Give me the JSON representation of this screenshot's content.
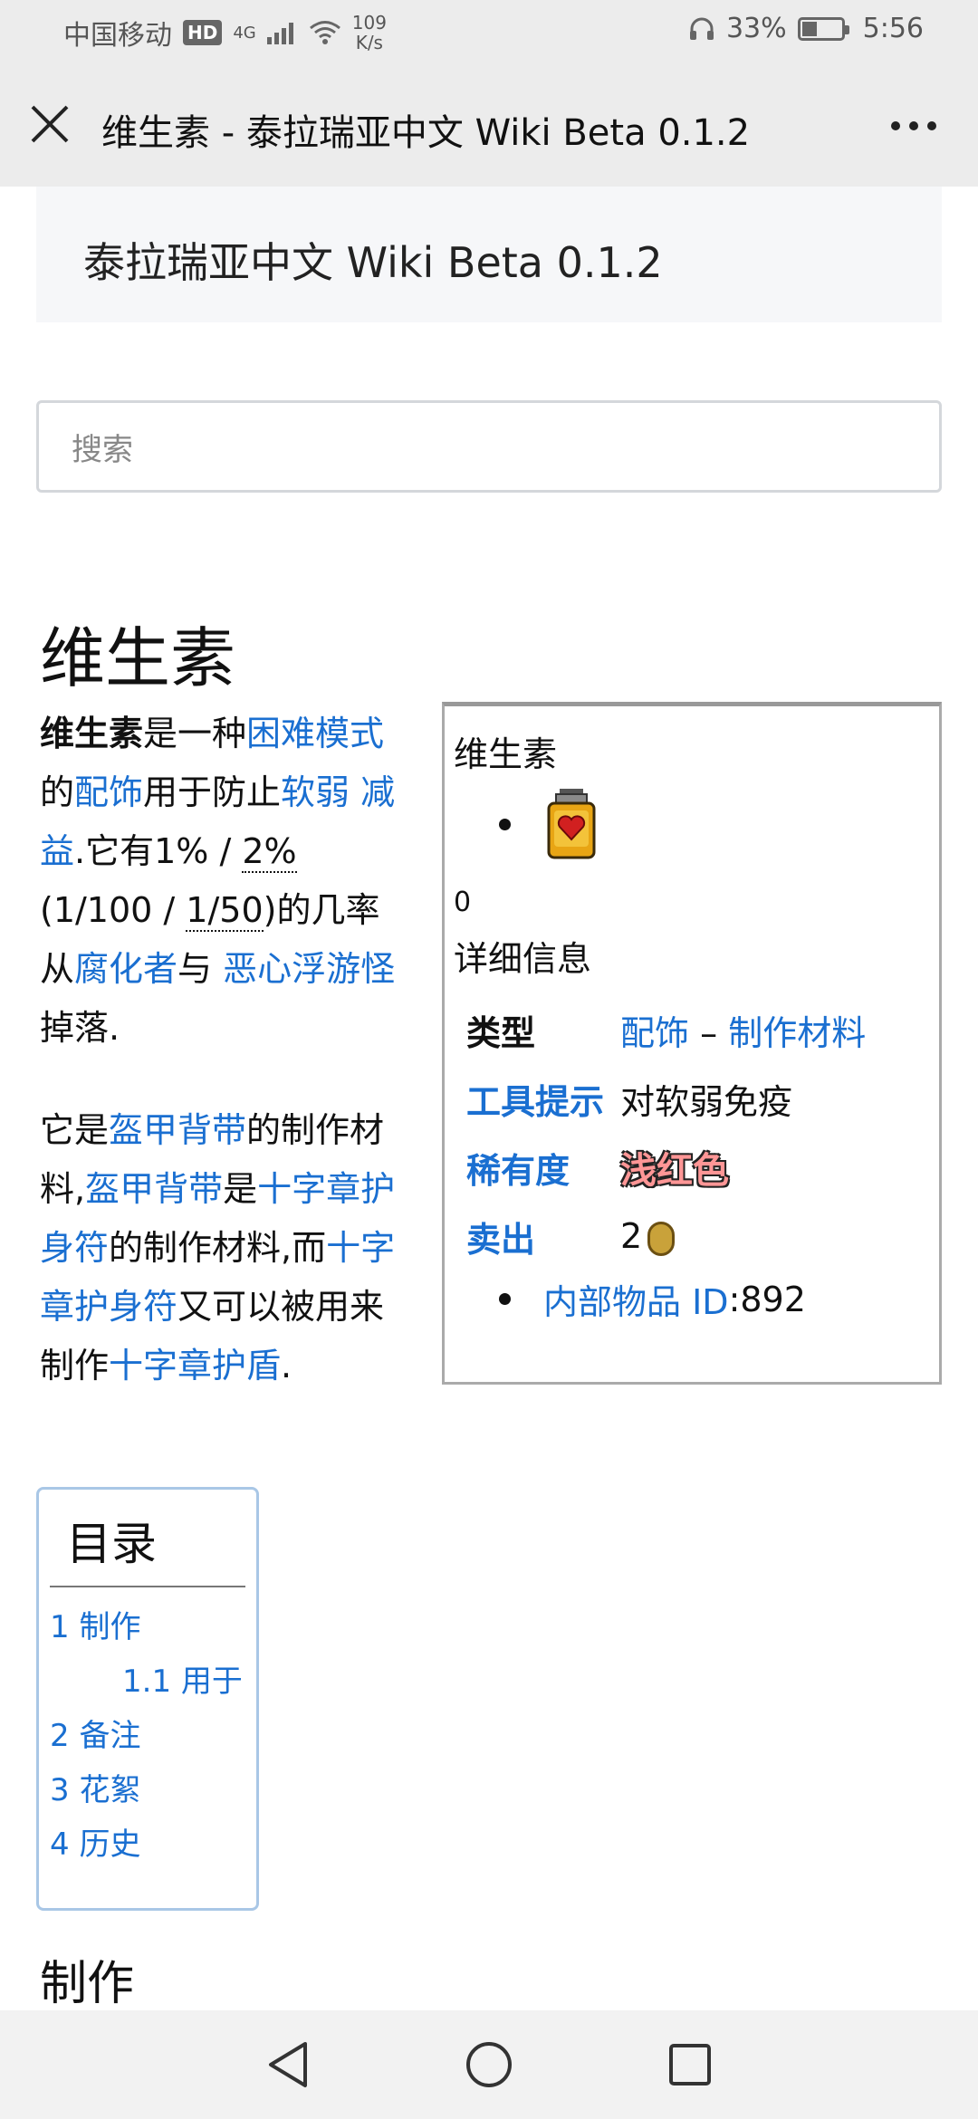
{
  "status": {
    "carrier": "中国移动",
    "hd": "HD",
    "net": "4G",
    "speed_value": "109",
    "speed_unit": "K/s",
    "battery": "33%",
    "time": "5:56"
  },
  "appbar": {
    "title": "维生素 - 泰拉瑞亚中文 Wiki Beta 0.1.2"
  },
  "site": {
    "banner": "泰拉瑞亚中文 Wiki Beta 0.1.2",
    "search_placeholder": "搜索"
  },
  "page": {
    "title": "维生素",
    "p1": {
      "term": "维生素",
      "t1": "是一种",
      "l1": "困难模式",
      "t2": "的",
      "l2": "配饰",
      "t3": "用于防止",
      "l3": "软弱 减益",
      "t4": ".它有1% / ",
      "abbr1": "2%",
      "t5": "(1/100 / ",
      "abbr2": "1/50",
      "t6": ")的几率从",
      "l4": "腐化者",
      "t7": "与 ",
      "l5": "恶心浮游怪",
      "t8": "掉落."
    },
    "p2": {
      "t1": "它是",
      "l1": "盔甲背带",
      "t2": "的制作材料,",
      "l2": "盔甲背带",
      "t3": "是",
      "l3": "十字章护身符",
      "t4": "的制作材料,而",
      "l4": "十字章护身符",
      "t5": "又可以被用来制作",
      "l5": "十字章护盾",
      "t6": "."
    }
  },
  "infobox": {
    "title": "维生素",
    "zero": "0",
    "details_heading": "详细信息",
    "type_label": "类型",
    "type_link1": "配饰",
    "type_sep": " – ",
    "type_link2": "制作材料",
    "tooltip_label": "工具提示",
    "tooltip_value": "对软弱免疫",
    "rarity_label": "稀有度",
    "rarity_value": "浅红色",
    "sell_label": "卖出",
    "sell_value": "2",
    "id_label": "内部物品 ID",
    "id_sep": ": ",
    "id_value": "892",
    "colors": {
      "rarity": "#ff9696",
      "link": "#1a6fd1"
    }
  },
  "toc": {
    "title": "目录",
    "items": [
      {
        "label": "1 制作"
      },
      {
        "label": "1.1 用于"
      },
      {
        "label": "2 备注"
      },
      {
        "label": "3 花絮"
      },
      {
        "label": "4 历史"
      }
    ]
  },
  "section": {
    "crafting": "制作"
  },
  "icons": {
    "close": "close-icon",
    "more": "more-icon",
    "back": "back-triangle-icon",
    "home": "home-circle-icon",
    "recents": "recents-square-icon"
  }
}
